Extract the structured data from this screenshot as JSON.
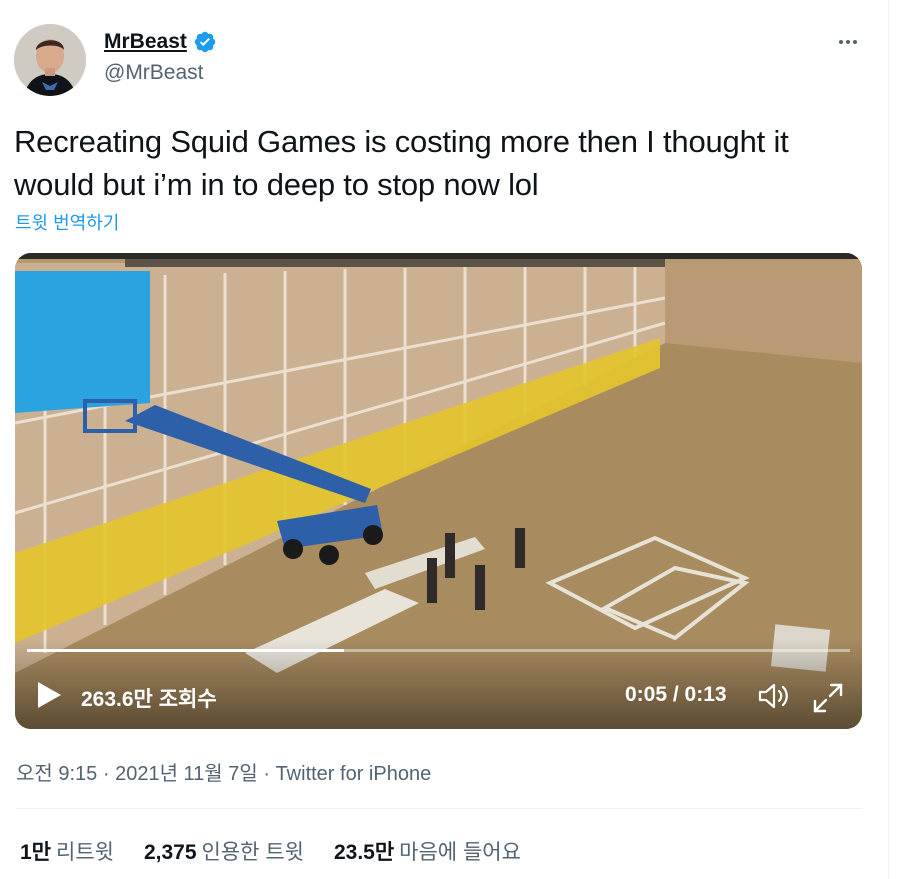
{
  "author": {
    "display_name": "MrBeast",
    "handle": "@MrBeast",
    "verified_color": "#1d9bf0"
  },
  "tweet": {
    "text": "Recreating Squid Games is costing more then I thought it would but i’m in to deep to stop now lol",
    "translate_label": "트윗 번역하기"
  },
  "video": {
    "views_label": "263.6만 조회수",
    "time_label": "0:05 / 0:13",
    "progress": 0.385
  },
  "meta": {
    "time": "오전 9:15",
    "separator": " · ",
    "date": "2021년 11월 7일",
    "app": "Twitter for iPhone"
  },
  "stats": {
    "retweets_value": "1만",
    "retweets_label": "리트윗",
    "quotes_value": "2,375",
    "quotes_label": "인용한 트윗",
    "likes_value": "23.5만",
    "likes_label": "마음에 들어요"
  },
  "icons": [
    "more-icon",
    "verified-badge-icon",
    "play-icon",
    "volume-icon",
    "fullscreen-icon"
  ],
  "colors": {
    "accent": "#1d9bf0",
    "secondary_text": "#536471",
    "primary_text": "#0f1419"
  }
}
